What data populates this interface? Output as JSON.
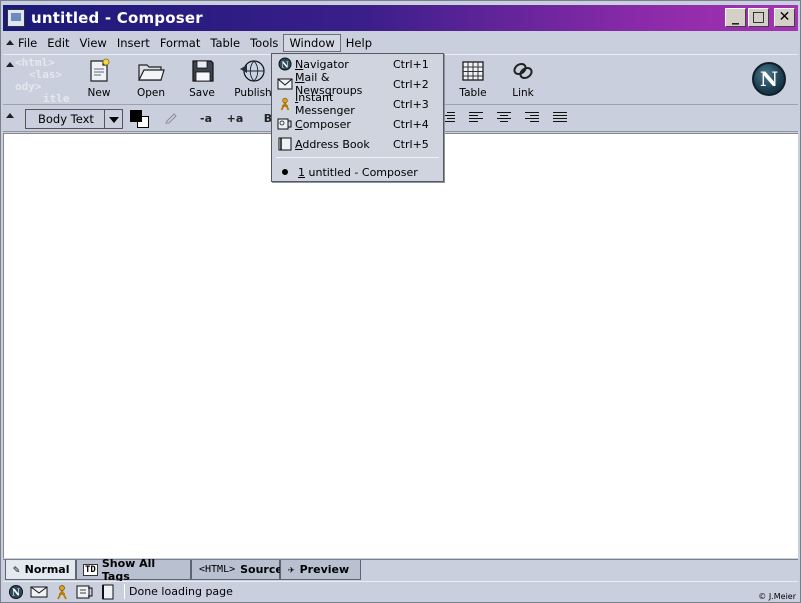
{
  "window": {
    "title": "untitled - Composer",
    "controls": {
      "minimize": "_",
      "maximize": "□",
      "close": "✕"
    }
  },
  "menubar": {
    "items": [
      {
        "label": "File",
        "icon": ""
      },
      {
        "label": "Edit"
      },
      {
        "label": "View"
      },
      {
        "label": "Insert"
      },
      {
        "label": "Format"
      },
      {
        "label": "Table"
      },
      {
        "label": "Tools"
      },
      {
        "label": "Window"
      },
      {
        "label": "Help"
      }
    ]
  },
  "toolbar": {
    "logo_lines": [
      "<html>",
      "<las>",
      "ody>",
      "itle"
    ],
    "buttons": [
      {
        "label": "New",
        "icon": "new-page-icon"
      },
      {
        "label": "Open",
        "icon": "folder-icon"
      },
      {
        "label": "Save",
        "icon": "floppy-icon"
      },
      {
        "label": "Publish",
        "icon": "globe-icon"
      },
      {
        "label": "Table",
        "icon": "table-icon"
      },
      {
        "label": "Link",
        "icon": "link-icon"
      }
    ],
    "brand_letter": "N"
  },
  "formatbar": {
    "paragraph_style": "Body Text",
    "buttons": {
      "smaller": "-a",
      "larger": "+a",
      "bold": "B"
    },
    "colors": {
      "text": "#000000",
      "background": "#ffffff"
    }
  },
  "window_menu": {
    "items": [
      {
        "label": "Navigator",
        "accel": "Ctrl+1",
        "icon": "navigator-icon",
        "underline": "N",
        "rest": "avigator"
      },
      {
        "label": "Mail & Newsgroups",
        "accel": "Ctrl+2",
        "icon": "mail-icon",
        "underline": "M",
        "rest": "ail & Newsgroups"
      },
      {
        "label": "Instant Messenger",
        "accel": "Ctrl+3",
        "icon": "messenger-icon",
        "underline": "I",
        "rest": "nstant Messenger"
      },
      {
        "label": "Composer",
        "accel": "Ctrl+4",
        "icon": "composer-icon",
        "underline": "C",
        "rest": "omposer"
      },
      {
        "label": "Address Book",
        "accel": "Ctrl+5",
        "icon": "address-book-icon",
        "underline": "A",
        "rest": "ddress Book"
      }
    ],
    "open_window": {
      "number": "1",
      "label": " untitled - Composer"
    }
  },
  "edit_tabs": [
    {
      "label": "Normal",
      "icon": "✎",
      "active": true
    },
    {
      "label": "Show All Tags",
      "icon": "TD",
      "active": false
    },
    {
      "label": "Source",
      "icon": "<HTML>",
      "active": false
    },
    {
      "label": "Preview",
      "icon": "✈",
      "active": false
    }
  ],
  "statusbar": {
    "text": "Done loading page",
    "copyright": "© J.Meier"
  }
}
